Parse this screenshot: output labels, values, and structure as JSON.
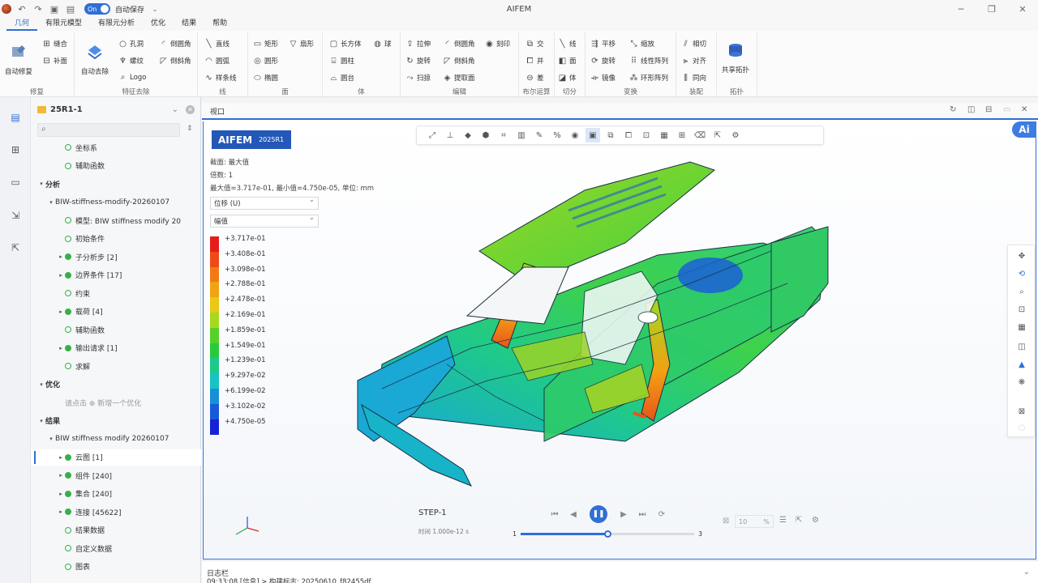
{
  "window": {
    "title": "AIFEM",
    "autosave_toggle": "On",
    "autosave_label": "自动保存"
  },
  "menu_tabs": [
    "几何",
    "有限元模型",
    "有限元分析",
    "优化",
    "结果",
    "帮助"
  ],
  "ribbon": {
    "repair": {
      "big1": "自动修复",
      "i1": "缝合",
      "i2": "补面",
      "label": "修复"
    },
    "feature": {
      "big1": "自动去除",
      "i1": "孔洞",
      "i2": "螺纹",
      "i3": "Logo",
      "i4": "倒圆角",
      "i5": "倒斜角",
      "label": "特征去除"
    },
    "line": {
      "i1": "直线",
      "i2": "圆弧",
      "i3": "样条线",
      "label": "线"
    },
    "face": {
      "i1": "矩形",
      "i2": "圆形",
      "i3": "椭圆",
      "i4": "扇形",
      "label": "面"
    },
    "body": {
      "i1": "长方体",
      "i2": "圆柱",
      "i3": "圆台",
      "i4": "球",
      "label": "体"
    },
    "edit": {
      "i1": "拉伸",
      "i2": "旋转",
      "i3": "扫掠",
      "i4": "倒圆角",
      "i5": "倒斜角",
      "i6": "提取面",
      "i7": "刻印",
      "label": "编辑"
    },
    "bool": {
      "i1": "交",
      "i2": "并",
      "i3": "差",
      "label": "布尔运算"
    },
    "cut": {
      "i1": "线",
      "i2": "面",
      "i3": "体",
      "label": "切分"
    },
    "transform": {
      "i1": "平移",
      "i2": "旋转",
      "i3": "镜像",
      "i4": "缩放",
      "i5": "线性阵列",
      "i6": "环形阵列",
      "label": "变换"
    },
    "assembly": {
      "i1": "相切",
      "i2": "对齐",
      "i3": "同向",
      "label": "装配"
    },
    "topo": {
      "big1": "共享拓扑",
      "label": "拓扑"
    }
  },
  "tree": {
    "project": "25R1-1",
    "rows": [
      {
        "text": "坐标系",
        "indent": 2,
        "dot": "hollow"
      },
      {
        "text": "辅助函数",
        "indent": 2,
        "dot": "hollow"
      },
      {
        "text": "分析",
        "indent": 0,
        "bold": true,
        "arrow": "down"
      },
      {
        "text": "BIW-stiffness-modify-20260107",
        "indent": 1,
        "arrow": "down"
      },
      {
        "text": "模型: BIW stiffness modify 20",
        "indent": 2,
        "dot": "hollow"
      },
      {
        "text": "初始条件",
        "indent": 2,
        "dot": "hollow"
      },
      {
        "text": "子分析步 [2]",
        "indent": 2,
        "dot": "filled",
        "arrow": "right"
      },
      {
        "text": "边界条件 [17]",
        "indent": 2,
        "dot": "filled",
        "arrow": "right"
      },
      {
        "text": "约束",
        "indent": 2,
        "dot": "hollow"
      },
      {
        "text": "载荷 [4]",
        "indent": 2,
        "dot": "filled",
        "arrow": "right"
      },
      {
        "text": "辅助函数",
        "indent": 2,
        "dot": "hollow"
      },
      {
        "text": "输出请求 [1]",
        "indent": 2,
        "dot": "filled",
        "arrow": "right"
      },
      {
        "text": "求解",
        "indent": 2,
        "dot": "hollow"
      },
      {
        "text": "优化",
        "indent": 0,
        "bold": true,
        "arrow": "down"
      },
      {
        "text": "请点击 ⊕ 新增一个优化",
        "indent": 2,
        "muted": true
      },
      {
        "text": "结果",
        "indent": 0,
        "bold": true,
        "arrow": "down"
      },
      {
        "text": "BIW stiffness modify 20260107",
        "indent": 1,
        "arrow": "down"
      },
      {
        "text": "云图 [1]",
        "indent": 2,
        "dot": "filled",
        "arrow": "right",
        "selected": true
      },
      {
        "text": "组件 [240]",
        "indent": 2,
        "dot": "filled",
        "arrow": "right"
      },
      {
        "text": "集合 [240]",
        "indent": 2,
        "dot": "filled",
        "arrow": "right"
      },
      {
        "text": "连接 [45622]",
        "indent": 2,
        "dot": "filled",
        "arrow": "right"
      },
      {
        "text": "结果数据",
        "indent": 2,
        "dot": "hollow"
      },
      {
        "text": "自定义数据",
        "indent": 2,
        "dot": "hollow"
      },
      {
        "text": "图表",
        "indent": 2,
        "dot": "hollow"
      }
    ]
  },
  "viewport": {
    "tab_label": "视口",
    "badge": "AIFEM",
    "badge_version": "2025R1",
    "section_line": "截面: 最大值",
    "scale_line": "倍数: 1",
    "range_line": "最大值=3.717e-01, 最小值=4.750e-05, 单位: mm",
    "select_field": "位移 (U)",
    "select_component": "幅值",
    "legend": [
      {
        "label": "+3.717e-01",
        "color": "#e81b1b"
      },
      {
        "label": "+3.408e-01",
        "color": "#ee4a17"
      },
      {
        "label": "+3.098e-01",
        "color": "#f27a15"
      },
      {
        "label": "+2.788e-01",
        "color": "#f1a313"
      },
      {
        "label": "+2.478e-01",
        "color": "#e8c913"
      },
      {
        "label": "+2.169e-01",
        "color": "#a6d81d"
      },
      {
        "label": "+1.859e-01",
        "color": "#57d12a"
      },
      {
        "label": "+1.549e-01",
        "color": "#29c93d"
      },
      {
        "label": "+1.239e-01",
        "color": "#1dc98a"
      },
      {
        "label": "+9.297e-02",
        "color": "#18c2c7"
      },
      {
        "label": "+6.199e-02",
        "color": "#1790d8"
      },
      {
        "label": "+3.102e-02",
        "color": "#1759d9"
      },
      {
        "label": "+4.750e-05",
        "color": "#1622d6"
      }
    ],
    "step_label": "STEP-1",
    "time_label": "时间 1.000e-12 s",
    "slider_min": "1",
    "slider_max": "3",
    "slider_value": 2,
    "zoom_value": "10",
    "zoom_unit": "%"
  },
  "log": {
    "title": "日志栏",
    "line": "09:33:08 [信息] > 构建标志: 20250610_f82455df"
  }
}
